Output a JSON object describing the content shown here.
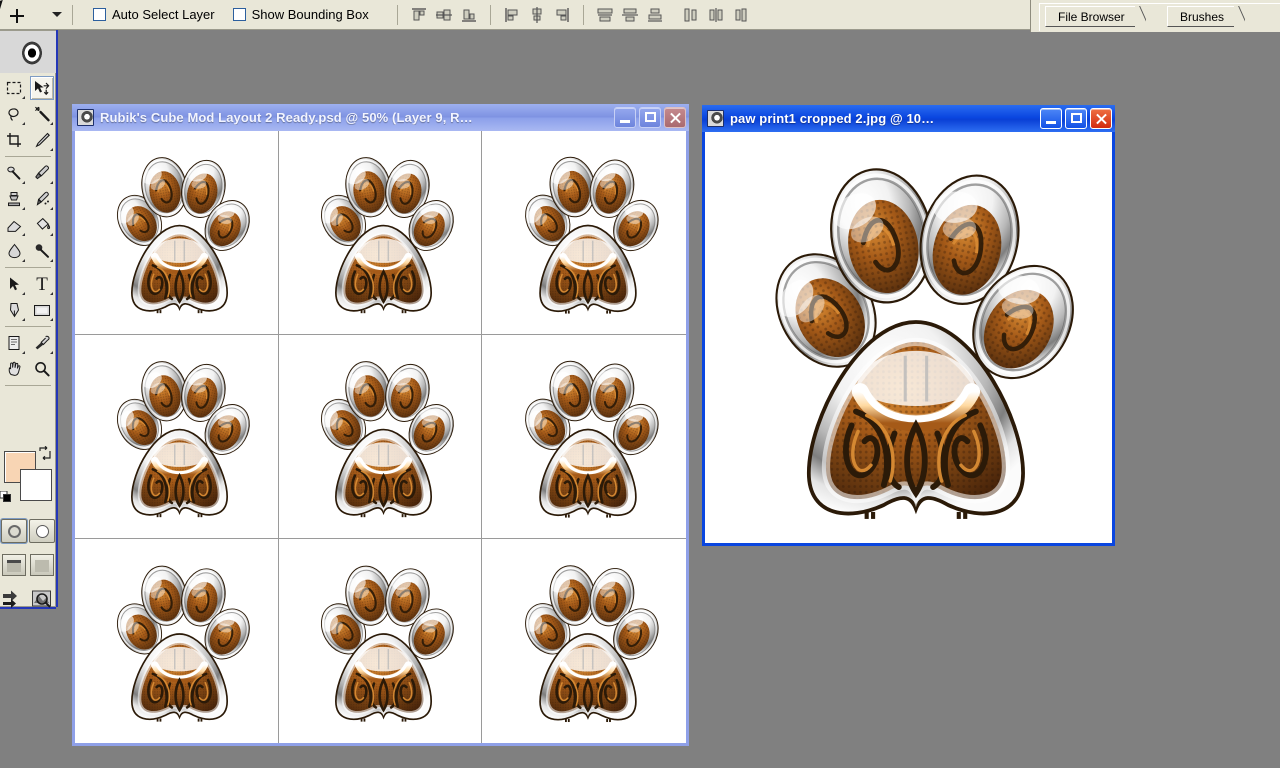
{
  "app": {
    "desktop_color": "#808080",
    "panel_color": "#e9e7d8"
  },
  "options_bar": {
    "active_tool_icon": "move-tool-icon",
    "tool_preset_chevron": "chevron-down-icon",
    "checkboxes": [
      {
        "label": "Auto Select Layer",
        "checked": false
      },
      {
        "label": "Show Bounding Box",
        "checked": false
      }
    ],
    "align_buttons": [
      {
        "name": "align-top-edges",
        "title": "Align top edges"
      },
      {
        "name": "align-vertical-centers",
        "title": "Align vertical centers"
      },
      {
        "name": "align-bottom-edges",
        "title": "Align bottom edges"
      },
      {
        "name": "align-left-edges",
        "title": "Align left edges"
      },
      {
        "name": "align-horizontal-centers",
        "title": "Align horizontal centers"
      },
      {
        "name": "align-right-edges",
        "title": "Align right edges"
      }
    ],
    "distribute_buttons": [
      {
        "name": "distribute-top-edges",
        "title": "Distribute top edges"
      },
      {
        "name": "distribute-vertical-centers",
        "title": "Distribute vertical centers"
      },
      {
        "name": "distribute-bottom-edges",
        "title": "Distribute bottom edges"
      },
      {
        "name": "distribute-left-edges",
        "title": "Distribute left edges"
      },
      {
        "name": "distribute-horizontal-centers",
        "title": "Distribute horizontal centers"
      },
      {
        "name": "distribute-right-edges",
        "title": "Distribute right edges"
      }
    ]
  },
  "palette_dock": {
    "tabs": [
      {
        "label": "File Browser",
        "active": false
      },
      {
        "label": "Brushes",
        "active": false
      }
    ]
  },
  "toolbox": {
    "selected_tool": "move-tool",
    "tools": [
      {
        "name": "marquee-tool",
        "icon": "marquee-icon",
        "has_flyout": true,
        "selected": false
      },
      {
        "name": "move-tool",
        "icon": "move-icon",
        "has_flyout": false,
        "selected": true
      },
      {
        "name": "lasso-tool",
        "icon": "lasso-icon",
        "has_flyout": true,
        "selected": false
      },
      {
        "name": "magic-wand-tool",
        "icon": "magic-wand-icon",
        "has_flyout": false,
        "selected": false
      },
      {
        "name": "crop-tool",
        "icon": "crop-icon",
        "has_flyout": false,
        "selected": false
      },
      {
        "name": "slice-tool",
        "icon": "slice-icon",
        "has_flyout": true,
        "selected": false
      },
      {
        "name": "healing-brush-tool",
        "icon": "healing-brush-icon",
        "has_flyout": true,
        "selected": false
      },
      {
        "name": "brush-tool",
        "icon": "brush-icon",
        "has_flyout": true,
        "selected": false
      },
      {
        "name": "clone-stamp-tool",
        "icon": "clone-stamp-icon",
        "has_flyout": true,
        "selected": false
      },
      {
        "name": "history-brush-tool",
        "icon": "history-brush-icon",
        "has_flyout": true,
        "selected": false
      },
      {
        "name": "eraser-tool",
        "icon": "eraser-icon",
        "has_flyout": true,
        "selected": false
      },
      {
        "name": "paint-bucket-tool",
        "icon": "paint-bucket-icon",
        "has_flyout": true,
        "selected": false
      },
      {
        "name": "blur-tool",
        "icon": "blur-drop-icon",
        "has_flyout": true,
        "selected": false
      },
      {
        "name": "dodge-tool",
        "icon": "dodge-icon",
        "has_flyout": true,
        "selected": false
      },
      {
        "name": "path-selection-tool",
        "icon": "path-arrow-icon",
        "has_flyout": true,
        "selected": false
      },
      {
        "name": "type-tool",
        "icon": "type-t-icon",
        "has_flyout": true,
        "selected": false
      },
      {
        "name": "pen-tool",
        "icon": "pen-icon",
        "has_flyout": true,
        "selected": false
      },
      {
        "name": "shape-tool",
        "icon": "rectangle-shape-icon",
        "has_flyout": true,
        "selected": false
      },
      {
        "name": "notes-tool",
        "icon": "notes-icon",
        "has_flyout": true,
        "selected": false
      },
      {
        "name": "eyedropper-tool",
        "icon": "eyedropper-icon",
        "has_flyout": true,
        "selected": false
      },
      {
        "name": "hand-tool",
        "icon": "hand-icon",
        "has_flyout": false,
        "selected": false
      },
      {
        "name": "zoom-tool",
        "icon": "magnifier-icon",
        "has_flyout": false,
        "selected": false
      }
    ],
    "colors": {
      "foreground": "#f8d5b4",
      "background": "#ffffff",
      "swap_icon": "swap-colors-icon",
      "default_icon": "default-colors-icon"
    },
    "mask_modes": [
      {
        "name": "standard-mode",
        "selected": true
      },
      {
        "name": "quick-mask-mode",
        "selected": false
      }
    ],
    "screen_modes": [
      {
        "name": "standard-screen-mode"
      },
      {
        "name": "full-screen-with-menu-mode"
      }
    ],
    "jump_buttons": [
      {
        "name": "jump-to-imageready-button",
        "icon": "jump-arrows-icon"
      },
      {
        "name": "jump-to-preview-button",
        "icon": "image-preview-icon"
      }
    ]
  },
  "documents": [
    {
      "id": "doc-rubiks-layout",
      "title": "Rubik's Cube Mod Layout 2 Ready.psd @ 50% (Layer 9, R…",
      "active": false,
      "zoom": "50%",
      "layer": "Layer 9",
      "icon": "photoshop-document-icon",
      "buttons": [
        "minimize",
        "maximize",
        "close"
      ],
      "canvas": {
        "background": "#ffffff",
        "grid_rows": 3,
        "grid_cols": 3,
        "guide_color": "#9a9a9a",
        "content": "paw-print-tiled-grid"
      }
    },
    {
      "id": "doc-paw-print1",
      "title": "paw print1 cropped 2.jpg @ 10…",
      "active": true,
      "zoom": "10…",
      "icon": "photoshop-document-icon",
      "buttons": [
        "minimize",
        "maximize",
        "close"
      ],
      "canvas": {
        "background": "#ffffff",
        "content": "paw-print-single"
      }
    }
  ],
  "artwork": {
    "name": "ornate-paw-print",
    "palette": {
      "orange_dark": "#6b3a10",
      "orange_mid": "#a55a18",
      "orange_light": "#d98c34",
      "highlight": "#ffffff",
      "glow": "#ffd9a0",
      "outline": "#2b1a08",
      "chrome_light": "#f4f4f4",
      "chrome_mid": "#b8b8b8",
      "chrome_dark": "#555555"
    },
    "parts": [
      {
        "name": "toe-pad-outer-left",
        "shape": "ellipse",
        "rotation": -28
      },
      {
        "name": "toe-pad-inner-left",
        "shape": "ellipse",
        "rotation": -10
      },
      {
        "name": "toe-pad-inner-right",
        "shape": "ellipse",
        "rotation": 12
      },
      {
        "name": "toe-pad-outer-right",
        "shape": "ellipse",
        "rotation": 30
      },
      {
        "name": "main-pad",
        "shape": "heart-triangle",
        "rotation": 0
      }
    ]
  }
}
